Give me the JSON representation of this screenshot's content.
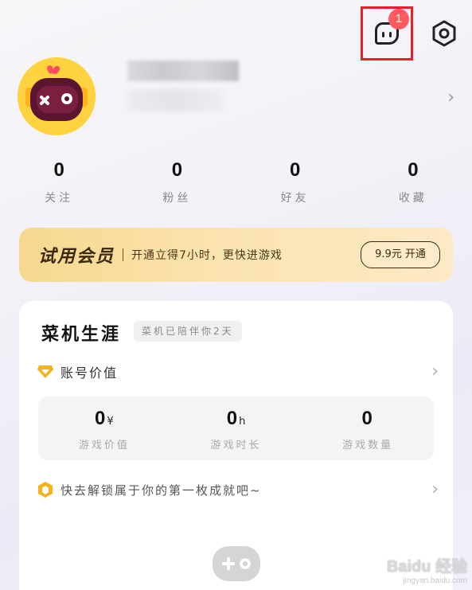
{
  "header": {
    "message_badge": "1",
    "message_icon": "message-bubble-icon",
    "settings_icon": "settings-icon"
  },
  "profile": {
    "arrow": "›"
  },
  "stats": [
    {
      "value": "0",
      "label": "关注"
    },
    {
      "value": "0",
      "label": "粉丝"
    },
    {
      "value": "0",
      "label": "好友"
    },
    {
      "value": "0",
      "label": "收藏"
    }
  ],
  "vip": {
    "title": "试用会员",
    "desc": "开通立得7小时，更快进游戏",
    "button": "9.9元 开通"
  },
  "career": {
    "title": "菜机生涯",
    "tag": "菜机已陪伴你2天",
    "account_value_label": "账号价值",
    "values": [
      {
        "num": "0",
        "unit": "¥",
        "label": "游戏价值"
      },
      {
        "num": "0",
        "unit": "h",
        "label": "游戏时长"
      },
      {
        "num": "0",
        "unit": "",
        "label": "游戏数量"
      }
    ],
    "achievement_hint": "快去解锁属于你的第一枚成就吧~"
  },
  "watermark": {
    "main": "Baidu 经验",
    "sub": "jingyan.baidu.com"
  },
  "colors": {
    "badge": "#ff5a5f",
    "highlight_box": "#e8202a",
    "vip_gradient_start": "#f6d88e",
    "avatar_bg": "#ffd23f"
  }
}
